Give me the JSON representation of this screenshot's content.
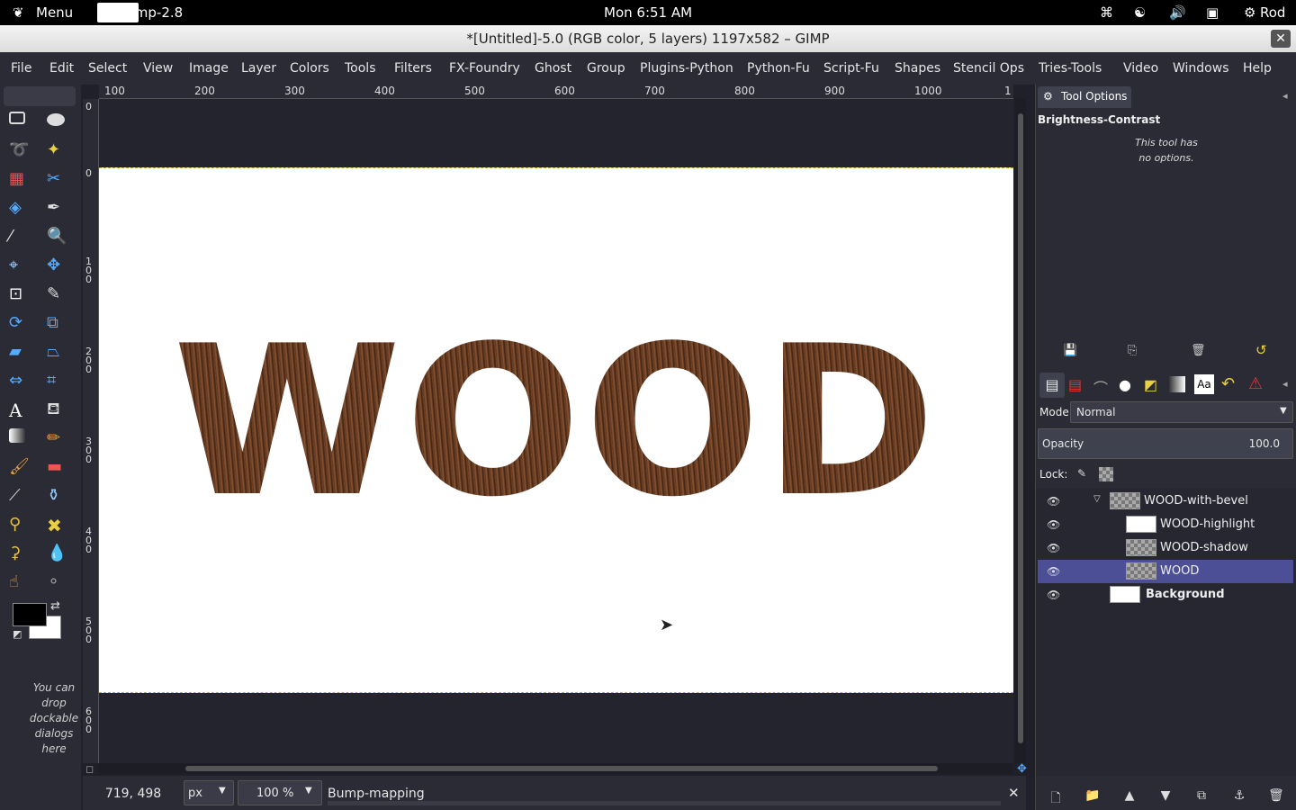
{
  "system_bar": {
    "menu_label": "Menu",
    "task_label": "Gimp-2.8",
    "clock": "Mon  6:51 AM",
    "user": "Rod"
  },
  "window": {
    "title": "*[Untitled]-5.0 (RGB color, 5 layers) 1197x582 – GIMP",
    "close_glyph": "✕"
  },
  "menubar": [
    "File",
    "Edit",
    "Select",
    "View",
    "Image",
    "Layer",
    "Colors",
    "Tools",
    "Filters",
    "FX-Foundry",
    "Ghost",
    "Group",
    "Plugins-Python",
    "Python-Fu",
    "Script-Fu",
    "Shapes",
    "Stencil Ops",
    "Tries-Tools",
    "Video",
    "Windows",
    "Help"
  ],
  "toolbox": {
    "drop_hint": "You can drop dockable dialogs here",
    "fg_color": "#000000",
    "bg_color": "#ffffff"
  },
  "rulers": {
    "top_ticks": [
      "100",
      "200",
      "300",
      "400",
      "500",
      "600",
      "700",
      "800",
      "900",
      "1000",
      "1"
    ],
    "left_ticks": [
      "0",
      "0",
      "100",
      "200",
      "300",
      "400",
      "500",
      "600"
    ]
  },
  "canvas": {
    "image_text": "WOOD"
  },
  "statusbar": {
    "coords": "719, 498",
    "unit": "px",
    "zoom": "100 %",
    "message": "Bump-mapping"
  },
  "tool_options": {
    "tab_label": "Tool Options",
    "tool_name": "Brightness-Contrast",
    "message": "This tool has no options."
  },
  "layers": {
    "mode_label": "Mode:",
    "mode_value": "Normal",
    "opacity_label": "Opacity",
    "opacity_value": "100.0",
    "lock_label": "Lock:",
    "items": [
      {
        "name": "WOOD-with-bevel",
        "bold": false
      },
      {
        "name": "WOOD-highlight",
        "bold": false
      },
      {
        "name": "WOOD-shadow",
        "bold": false
      },
      {
        "name": "WOOD",
        "bold": false
      },
      {
        "name": "Background",
        "bold": true
      }
    ]
  }
}
